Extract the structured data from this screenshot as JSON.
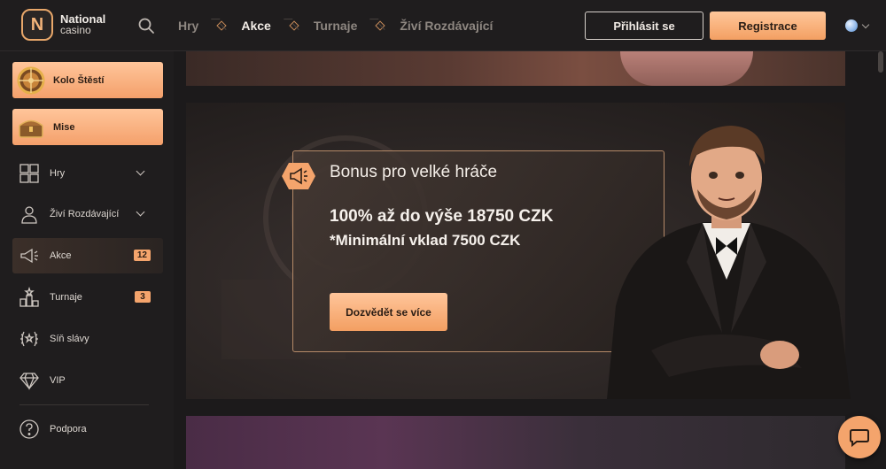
{
  "brand": {
    "name": "National",
    "sub": "casino",
    "letter": "N"
  },
  "nav": {
    "items": [
      {
        "label": "Hry",
        "active": false
      },
      {
        "label": "Akce",
        "active": true
      },
      {
        "label": "Turnaje",
        "active": false
      },
      {
        "label": "Živí Rozdávající",
        "active": false
      }
    ]
  },
  "auth": {
    "login_label": "Přihlásit se",
    "register_label": "Registrace"
  },
  "sidebar": {
    "promos": [
      {
        "label": "Kolo Štěstí",
        "icon": "wheel-icon"
      },
      {
        "label": "Mise",
        "icon": "treasure-chest-icon"
      }
    ],
    "items": [
      {
        "label": "Hry",
        "icon": "puzzle-icon",
        "expandable": true
      },
      {
        "label": "Živí Rozdávající",
        "icon": "dealer-icon",
        "expandable": true
      },
      {
        "label": "Akce",
        "icon": "megaphone-icon",
        "count": "12",
        "active": true
      },
      {
        "label": "Turnaje",
        "icon": "tournament-icon",
        "count": "3"
      },
      {
        "label": "Síň slávy",
        "icon": "laurel-icon"
      },
      {
        "label": "VIP",
        "icon": "diamond-icon"
      },
      {
        "label": "Podpora",
        "icon": "help-icon"
      }
    ]
  },
  "hero": {
    "title": "Bonus pro velké hráče",
    "line1": "100% až do výše 18750 CZK",
    "line2": "*Minimální vklad 7500 CZK",
    "cta": "Dozvědět se více"
  },
  "colors": {
    "accent": "#f4a46c",
    "accent_light": "#ffc59a",
    "background": "#1f1d1e"
  }
}
